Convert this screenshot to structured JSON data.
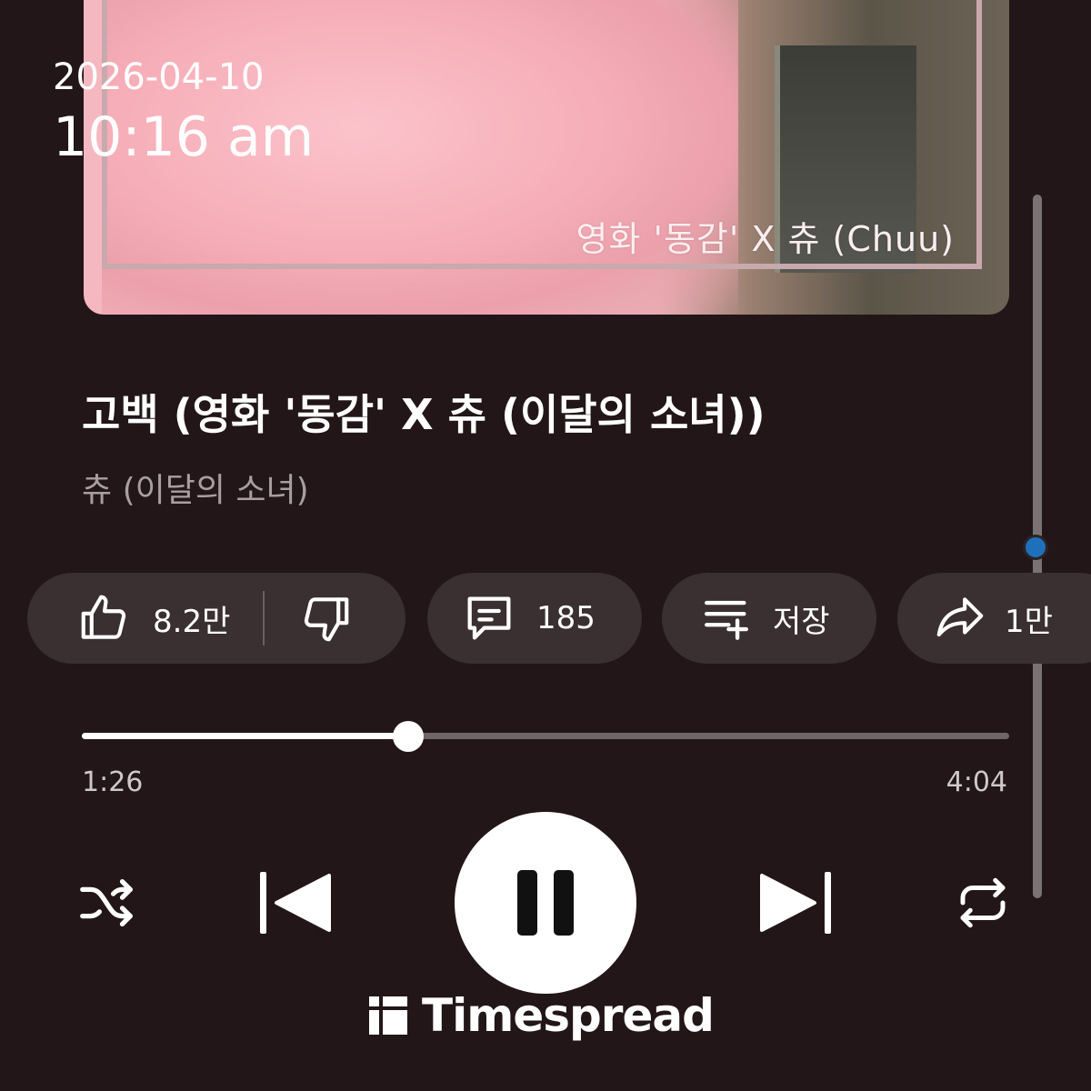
{
  "album_art": {
    "caption": "영화 '동감' X 츄 (Chuu)"
  },
  "overlay": {
    "date": "2026-04-10",
    "time": "10:16 am"
  },
  "track": {
    "title": "고백 (영화 '동감' X 츄 (이달의 소녀))",
    "artist": "츄 (이달의 소녀)"
  },
  "actions": {
    "like_count": "8.2만",
    "comment_count": "185",
    "save_label": "저장",
    "share_count": "1만"
  },
  "progress": {
    "current_time": "1:26",
    "total_time": "4:04",
    "fraction": 0.352
  },
  "icons": {
    "like": "thumbs-up-icon",
    "dislike": "thumbs-down-icon",
    "comment": "comment-icon",
    "save": "playlist-add-icon",
    "share": "share-icon",
    "shuffle": "shuffle-icon",
    "previous": "skip-previous-icon",
    "pause": "pause-icon",
    "next": "skip-next-icon",
    "repeat": "repeat-icon"
  },
  "colors": {
    "background": "#221618",
    "chip": "#3a2f31",
    "scroll_thumb": "#1f70bb"
  },
  "watermark": {
    "text": "Timespread"
  }
}
